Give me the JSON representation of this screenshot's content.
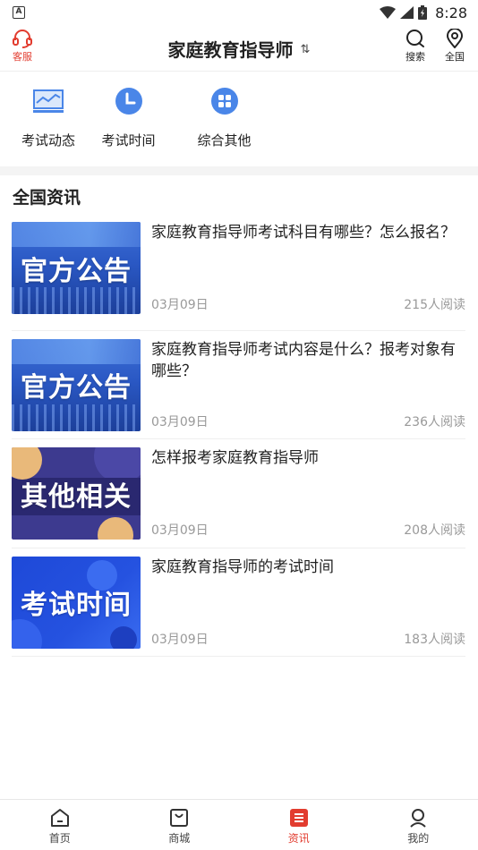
{
  "status_bar": {
    "time": "8:28",
    "badge": "A"
  },
  "header": {
    "service_label": "客服",
    "title": "家庭教育指导师",
    "switch_glyph": "⇅",
    "search_label": "搜索",
    "region_label": "全国"
  },
  "categories": [
    {
      "label": "考试动态",
      "icon": "chart-icon"
    },
    {
      "label": "考试时间",
      "icon": "clock-icon"
    },
    {
      "label": "综合其他",
      "icon": "grid-icon"
    }
  ],
  "section_title": "全国资讯",
  "news": [
    {
      "thumb_text": "官方公告",
      "title": "家庭教育指导师考试科目有哪些？怎么报名？",
      "date": "03月09日",
      "reads": "215人阅读"
    },
    {
      "thumb_text": "官方公告",
      "title": "家庭教育指导师考试内容是什么？报考对象有哪些？",
      "date": "03月09日",
      "reads": "236人阅读"
    },
    {
      "thumb_text": "其他相关",
      "title": "怎样报考家庭教育指导师",
      "date": "03月09日",
      "reads": "208人阅读"
    },
    {
      "thumb_text": "考试时间",
      "title": "家庭教育指导师的考试时间",
      "date": "03月09日",
      "reads": "183人阅读"
    }
  ],
  "bottom_nav": [
    {
      "label": "首页",
      "icon": "home-icon",
      "active": false
    },
    {
      "label": "商城",
      "icon": "bag-icon",
      "active": false
    },
    {
      "label": "资讯",
      "icon": "news-icon",
      "active": true
    },
    {
      "label": "我的",
      "icon": "profile-icon",
      "active": false
    }
  ],
  "colors": {
    "accent": "#e23c2f",
    "icon_blue": "#4a86e8"
  }
}
